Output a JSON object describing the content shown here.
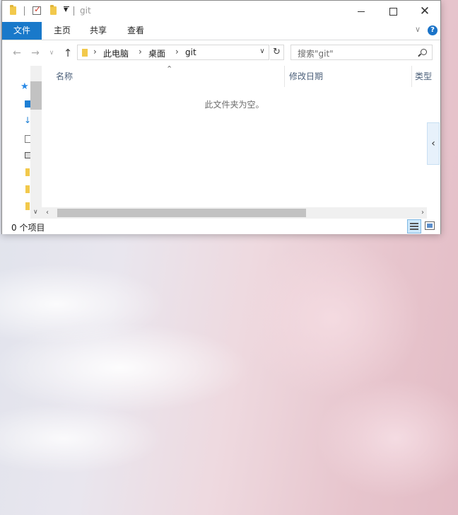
{
  "window": {
    "title": "git",
    "minimize_label": "",
    "maximize_label": "",
    "close_label": "✕"
  },
  "ribbon": {
    "tabs": [
      "文件",
      "主页",
      "共享",
      "查看"
    ],
    "help": "?"
  },
  "nav": {
    "back": "←",
    "forward": "→",
    "recent": "∨",
    "up": "↑",
    "breadcrumbs": [
      "此电脑",
      "桌面",
      "git"
    ],
    "crumb_separator": "›",
    "dropdown": "∨",
    "refresh": "↻"
  },
  "search": {
    "placeholder": "搜索\"git\""
  },
  "columns": {
    "name": "名称",
    "modified": "修改日期",
    "type": "类型"
  },
  "content": {
    "empty_message": "此文件夹为空。"
  },
  "status": {
    "item_count": "0 个项目"
  },
  "scroll": {
    "left": "‹",
    "right": "›",
    "down": "∨"
  },
  "pane_toggle": "‹",
  "colors": {
    "accent": "#1979ca",
    "folder": "#f2c94c"
  }
}
